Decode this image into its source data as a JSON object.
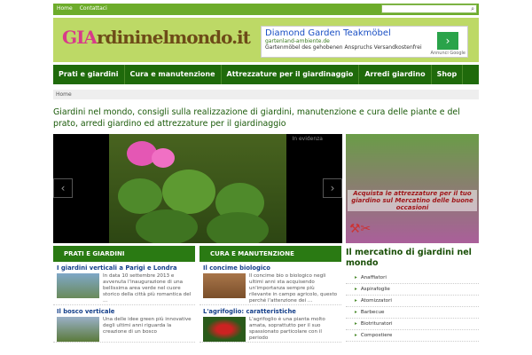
{
  "topbar": {
    "links": [
      "Home",
      "Contattaci"
    ]
  },
  "logo": "GIArdininelmondo.it",
  "ad": {
    "title": "Diamond Garden Teakmöbel",
    "url": "gartenland-ambiente.de",
    "desc": "Gartenmöbel des gehobenen Anspruchs Versandkostenfrei",
    "google": "Annunci Google"
  },
  "nav": [
    "Prati e giardini",
    "Cura e manutenzione",
    "Attrezzature per il giardinaggio",
    "Arredi giardino",
    "Shop"
  ],
  "breadcrumb": "Home",
  "intro": "Giardini nel mondo, consigli sulla realizzazione di giardini, manutenzione e cura delle piante e del prato, arredi giardino ed attrezzature per il giardinaggio",
  "slider": {
    "label": "In evidenza"
  },
  "banner": {
    "text": "Acquista le attrezzature per il tuo giardino sul Mercatino delle buone occasioni"
  },
  "columns": [
    {
      "header": "PRATI E GIARDINI",
      "articles": [
        {
          "title": "I giardini verticali a Parigi e Londra",
          "text": "In data 10 settembre 2013 e avvenuta l'inaugurazione di una bellissima area verde nel cuore storico della città più romantica del ..."
        },
        {
          "title": "Il bosco verticale",
          "text": "Una delle idee green più innovative degli ultimi anni riguarda la creazione di un bosco"
        }
      ]
    },
    {
      "header": "CURA E MANUTENZIONE",
      "articles": [
        {
          "title": "Il concime biologico",
          "text": "Il concime bio o biologico negli ultimi anni sta acquisendo un'importanza sempre più rilevante in campo agricolo, questo perché l'attenzione dei ..."
        },
        {
          "title": "L'agrifoglio: caratteristiche",
          "text": "L'agrifoglio è una pianta molto amata, soprattutto per il suo spassionato particolare con il periodo"
        }
      ]
    }
  ],
  "sidebar": {
    "title": "Il mercatino di giardini nel mondo",
    "items": [
      "Anaffiatori",
      "Aspirafoglie",
      "Atomizzatori",
      "Barbecue",
      "Biotrituratori",
      "Compostiere"
    ]
  }
}
